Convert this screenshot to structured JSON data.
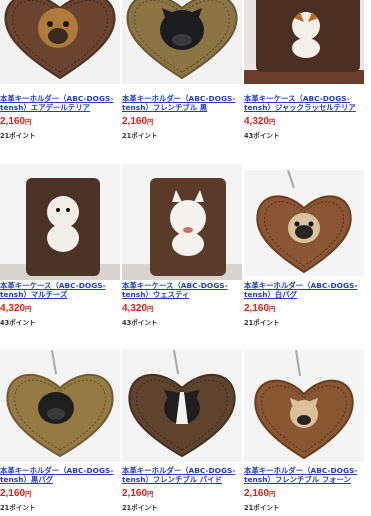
{
  "products": [
    {
      "id": "p1",
      "title": "本革キーホルダー（ABC-DOGS-tensh）エアデールテリア",
      "price": "2,160",
      "yen": "円",
      "points": "21ポイント",
      "type": "heart",
      "leather": "#6b4430",
      "dog": "airedale"
    },
    {
      "id": "p2",
      "title": "本革キーホルダー（ABC-DOGS-tensh）フレンチブル 黒",
      "price": "2,160",
      "yen": "円",
      "points": "21ポイント",
      "type": "heart",
      "leather": "#8a7444",
      "dog": "frenchie-black"
    },
    {
      "id": "p3",
      "title": "本革キーケース（ABC-DOGS-tensh）ジャックラッセルテリア",
      "price": "4,320",
      "yen": "円",
      "points": "43ポイント",
      "type": "case",
      "leather": "#4a2f22",
      "dog": "jack"
    },
    {
      "id": "p4",
      "title": "本革キーケース（ABC-DOGS-tensh）マルチーズ",
      "price": "4,320",
      "yen": "円",
      "points": "43ポイント",
      "type": "case",
      "leather": "#4b3226",
      "dog": "maltese"
    },
    {
      "id": "p5",
      "title": "本革キーケース（ABC-DOGS-tensh）ウェスティ",
      "price": "4,320",
      "yen": "円",
      "points": "43ポイント",
      "type": "case",
      "leather": "#5a3b29",
      "dog": "westie"
    },
    {
      "id": "p6",
      "title": "本革キーホルダー（ABC-DOGS-tensh）白パグ",
      "price": "2,160",
      "yen": "円",
      "points": "21ポイント",
      "type": "heart",
      "leather": "#8a5633",
      "dog": "pug-fawn"
    },
    {
      "id": "p7",
      "title": "本革キーホルダー（ABC-DOGS-tensh）黒パグ",
      "price": "2,160",
      "yen": "円",
      "points": "21ポイント",
      "type": "heart",
      "leather": "#957a44",
      "dog": "pug-black"
    },
    {
      "id": "p8",
      "title": "本革キーホルダー（ABC-DOGS-tensh）フレンチブル パイド",
      "price": "2,160",
      "yen": "円",
      "points": "21ポイント",
      "type": "heart",
      "leather": "#5f432e",
      "dog": "frenchie-pied"
    },
    {
      "id": "p9",
      "title": "本革キーホルダー（ABC-DOGS-tensh）フレンチブル フォーン",
      "price": "2,160",
      "yen": "円",
      "points": "21ポイント",
      "type": "heart",
      "leather": "#8a5733",
      "dog": "frenchie-fawn"
    }
  ]
}
